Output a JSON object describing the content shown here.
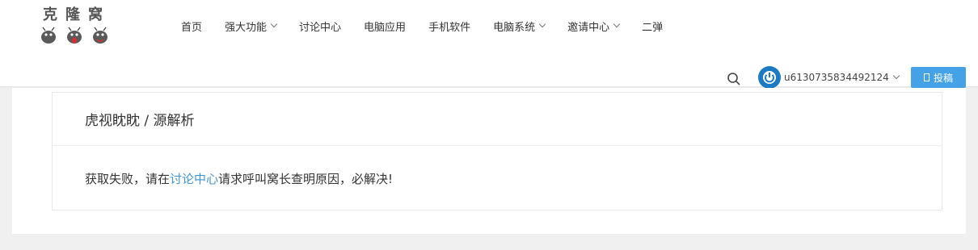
{
  "logo": {
    "text": "克隆窝"
  },
  "nav": {
    "items": [
      {
        "label": "首页",
        "dropdown": false
      },
      {
        "label": "强大功能",
        "dropdown": true
      },
      {
        "label": "讨论中心",
        "dropdown": false
      },
      {
        "label": "电脑应用",
        "dropdown": false
      },
      {
        "label": "手机软件",
        "dropdown": false
      },
      {
        "label": "电脑系统",
        "dropdown": true
      },
      {
        "label": "邀请中心",
        "dropdown": true
      },
      {
        "label": "二弹",
        "dropdown": false
      }
    ]
  },
  "user": {
    "name": "u6130735834492124"
  },
  "post_button": {
    "label": "投稿"
  },
  "card": {
    "title": "虎视眈眈 / 源解析",
    "message_before": "获取失败，请在",
    "message_link": "讨论中心",
    "message_after": "请求呼叫窝长查明原因，必解决!"
  },
  "colors": {
    "accent": "#45a2e6",
    "link": "#3d95d6",
    "avatar": "#1a7bc4",
    "page_bg": "#f0f0f0"
  }
}
